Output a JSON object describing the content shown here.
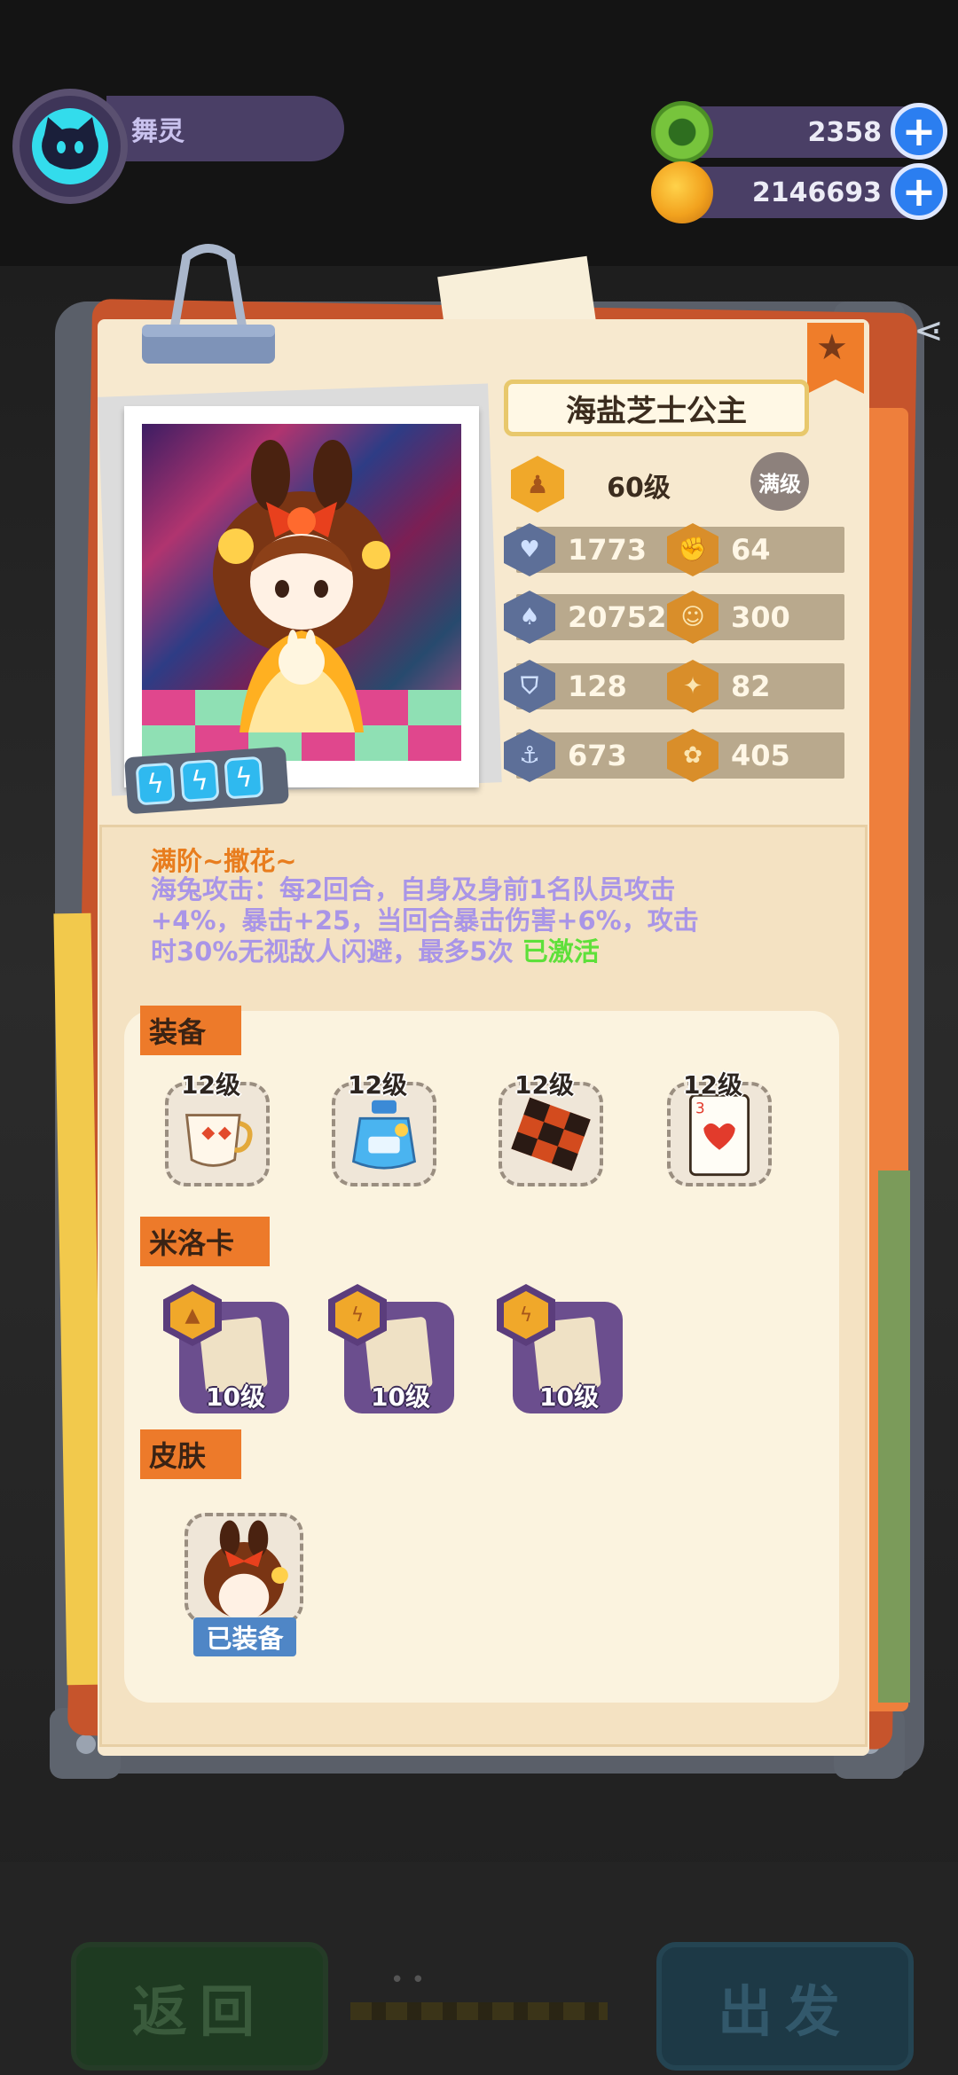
{
  "player": {
    "name": "舞灵",
    "avatar_icon": "cat-icon"
  },
  "currencies": [
    {
      "icon": "green-gem-icon",
      "value": "2358",
      "color": "#6fbf3a"
    },
    {
      "icon": "planet-coin-icon",
      "value": "2146693",
      "color": "#f2a21e"
    }
  ],
  "card": {
    "name": "海盐芝士公主",
    "level_label": "60级",
    "max_label": "满级",
    "stats": [
      {
        "icon": "heart-shield-icon",
        "value": "1773"
      },
      {
        "icon": "fist-icon",
        "value": "64"
      },
      {
        "icon": "attack-icon",
        "value": "20752"
      },
      {
        "icon": "smile-icon",
        "value": "300"
      },
      {
        "icon": "shield-icon",
        "value": "128"
      },
      {
        "icon": "muscle-icon",
        "value": "82"
      },
      {
        "icon": "anchor-icon",
        "value": "673"
      },
      {
        "icon": "brain-icon",
        "value": "405"
      }
    ],
    "charges": [
      "lightning-icon",
      "lightning-icon",
      "lightning-icon"
    ]
  },
  "skill": {
    "title": "满阶~撒花~",
    "description": "海兔攻击：每2回合，自身及身前1名队员攻击+4%，暴击+25，当回合暴击伤害+6%，攻击时30%无视敌人闪避，最多5次",
    "status": "已激活"
  },
  "sections": {
    "equipment": "装备",
    "miloka": "米洛卡",
    "skin": "皮肤"
  },
  "equipment": [
    {
      "icon": "teacup-icon",
      "level": "12级"
    },
    {
      "icon": "potion-bottle-icon",
      "level": "12级"
    },
    {
      "icon": "checker-board-icon",
      "level": "12级"
    },
    {
      "icon": "playing-card-icon",
      "level": "12级"
    }
  ],
  "miloka": [
    {
      "icon": "rocket-card-icon",
      "level": "10级"
    },
    {
      "icon": "lightning-card-icon",
      "level": "10级"
    },
    {
      "icon": "lightning-card-icon",
      "level": "10级"
    }
  ],
  "skin": {
    "equipped_label": "已装备"
  },
  "bottom": {
    "back": "返回",
    "go": "出发"
  }
}
